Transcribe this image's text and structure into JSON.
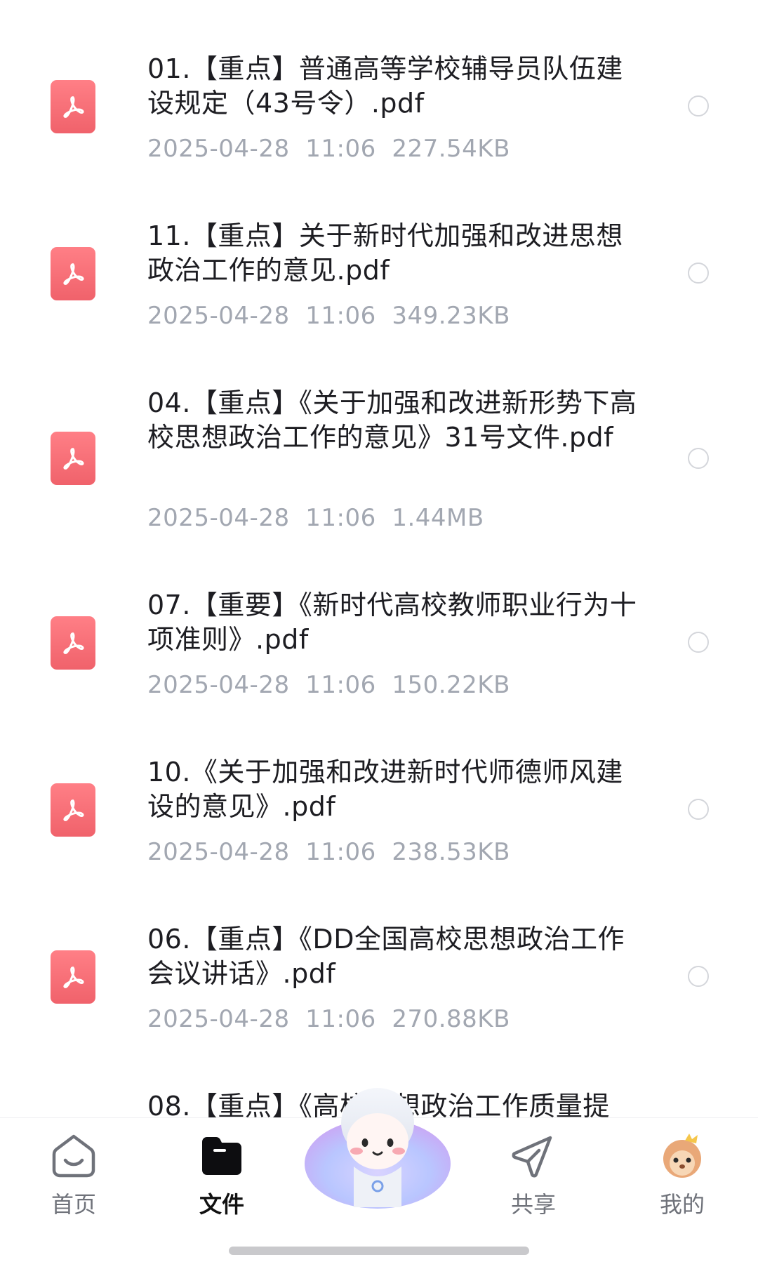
{
  "files": [
    {
      "name": "01.【重点】普通高等学校辅导员队伍建设规定（43号令）.pdf",
      "date": "2025-04-28",
      "time": "11:06",
      "size": "227.54KB"
    },
    {
      "name": "11.【重点】关于新时代加强和改进思想政治工作的意见.pdf",
      "date": "2025-04-28",
      "time": "11:06",
      "size": "349.23KB"
    },
    {
      "name": "04.【重点】《关于加强和改进新形势下高校思想政治工作的意见》31号文件.pdf",
      "date": "2025-04-28",
      "time": "11:06",
      "size": "1.44MB"
    },
    {
      "name": "07.【重要】《新时代高校教师职业行为十项准则》.pdf",
      "date": "2025-04-28",
      "time": "11:06",
      "size": "150.22KB"
    },
    {
      "name": "10.《关于加强和改进新时代师德师风建设的意见》.pdf",
      "date": "2025-04-28",
      "time": "11:06",
      "size": "238.53KB"
    },
    {
      "name": "06.【重点】《DD全国高校思想政治工作会议讲话》.pdf",
      "date": "2025-04-28",
      "time": "11:06",
      "size": "270.88KB"
    },
    {
      "name": "08.【重点】《高校思想政治工作质量提",
      "date": "",
      "time": "",
      "size": ""
    }
  ],
  "tabs": {
    "home": "首页",
    "files": "文件",
    "share": "共享",
    "mine": "我的"
  },
  "colors": {
    "pdf_icon": "#f0626b",
    "meta_text": "#a2a7b1",
    "active_tab": "#111111"
  },
  "icons": [
    "pdf-file-icon",
    "home-icon",
    "folder-icon",
    "mascot-assistant-icon",
    "share-icon",
    "avatar-icon"
  ]
}
